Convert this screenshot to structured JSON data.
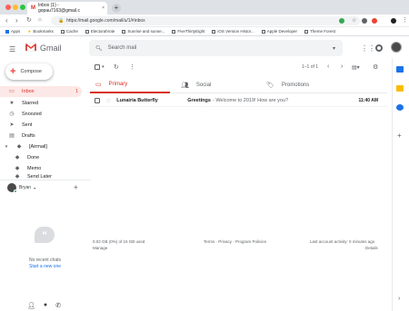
{
  "browser": {
    "tab_title": "Inbox (1) - gopau7163@gmail.c",
    "tab_close": "×",
    "new_tab": "+",
    "url": "https://mail.google.com/mail/u/1/#inbox",
    "bookmarks": [
      "Apps",
      "Bookmarks",
      "Cache",
      "ElectoralVote",
      "Sunrise and sunse...",
      "FiveThirtyEight",
      "iOS Version Histor...",
      "Apple Developer",
      "Theme Forest"
    ]
  },
  "gmail": {
    "brand": "Gmail",
    "search_placeholder": "Search mail",
    "compose_label": "Compose",
    "nav": [
      {
        "label": "Inbox",
        "count": "1",
        "icon": "inbox-icon"
      },
      {
        "label": "Starred",
        "count": "",
        "icon": "star-icon"
      },
      {
        "label": "Snoozed",
        "count": "",
        "icon": "clock-icon"
      },
      {
        "label": "Sent",
        "count": "",
        "icon": "send-icon"
      },
      {
        "label": "Drafts",
        "count": "",
        "icon": "draft-icon"
      },
      {
        "label": "[Airmail]",
        "count": "",
        "icon": "label-icon"
      },
      {
        "label": "Done",
        "count": "",
        "icon": "label-icon"
      },
      {
        "label": "Memo",
        "count": "",
        "icon": "label-icon"
      },
      {
        "label": "Send Later",
        "count": "",
        "icon": "label-icon"
      }
    ],
    "hangouts_user": "Bryan",
    "no_chats": "No recent chats",
    "start_chat": "Start a new one",
    "pagination": "1–1 of 1",
    "tabs": [
      {
        "label": "Primary",
        "icon": "inbox-icon"
      },
      {
        "label": "Social",
        "icon": "people-icon"
      },
      {
        "label": "Promotions",
        "icon": "tag-icon"
      }
    ],
    "email": {
      "sender": "Lunairia Butterfly",
      "subject": "Greetings",
      "snippet": "- Welcome to 2019! How are you?",
      "time": "11:40 AM"
    },
    "footer": {
      "storage": "0.02 GB (0%) of 15 GB used",
      "manage": "Manage",
      "links": "Terms · Privacy · Program Policies",
      "activity": "Last account activity: 0 minutes ago",
      "details": "Details"
    }
  },
  "colors": {
    "accent_red": "#d93025",
    "link_blue": "#1a73e8",
    "active_bg": "#fce8e6"
  }
}
